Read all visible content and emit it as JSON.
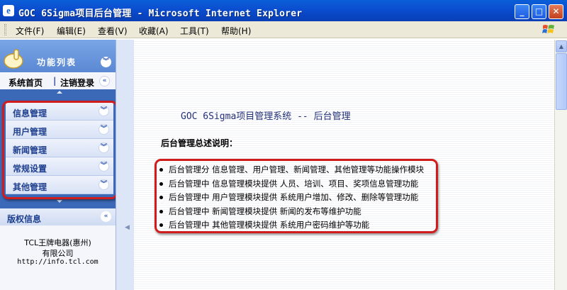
{
  "window": {
    "title": "GOC 6Sigma项目后台管理 - Microsoft Internet Explorer",
    "minimize": "_",
    "maximize": "□",
    "close": "✕"
  },
  "menubar": {
    "items": [
      "文件(F)",
      "编辑(E)",
      "查看(V)",
      "收藏(A)",
      "工具(T)",
      "帮助(H)"
    ]
  },
  "sidebar": {
    "header_title": "功能列表",
    "home_link": "系统首页",
    "separator": "|",
    "logout_link": "注销登录",
    "menu": [
      "信息管理",
      "用户管理",
      "新闻管理",
      "常规设置",
      "其他管理"
    ],
    "copyright": {
      "title": "版权信息",
      "line1": "TCL王牌电器(惠州)",
      "line2": "有限公司",
      "line3": "http://info.tcl.com"
    }
  },
  "main": {
    "heading": "GOC 6Sigma项目管理系统 -- 后台管理",
    "subheading": "后台管理总述说明：",
    "items": [
      "后台管理分  信息管理、用户管理、新闻管理、其他管理等功能操作模块",
      "后台管理中  信息管理模块提供  人员、培训、项目、奖项信息管理功能",
      "后台管理中  用户管理模块提供  系统用户增加、修改、删除等管理功能",
      "后台管理中  新闻管理模块提供  新闻的发布等维护功能",
      "后台管理中  其他管理模块提供  系统用户密码维护等功能"
    ]
  },
  "colors": {
    "highlight": "#d01c1c",
    "titlebar": "#0b4fd0",
    "sidebar": "#3b69b8"
  }
}
